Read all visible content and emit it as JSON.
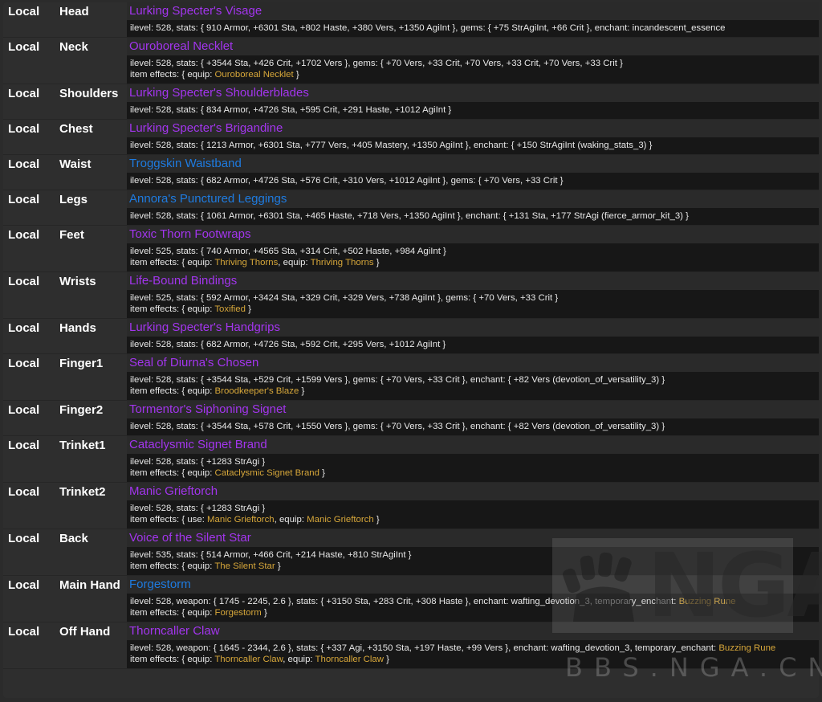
{
  "colors": {
    "epic": "#a335ee",
    "rare": "#1e7be0",
    "effect": "#d7a73a"
  },
  "items": [
    {
      "source": "Local",
      "slot": "Head",
      "name": "Lurking Specter's Visage",
      "quality": "epic",
      "stats": "ilevel: 528, stats: { 910 Armor, +6301 Sta, +802 Haste, +380 Vers, +1350 AgiInt }, gems: { +75 StrAgiInt, +66 Crit }, enchant: incandescent_essence",
      "effects": []
    },
    {
      "source": "Local",
      "slot": "Neck",
      "name": "Ouroboreal Necklet",
      "quality": "epic",
      "stats": "ilevel: 528, stats: { +3544 Sta, +426 Crit, +1702 Vers }, gems: { +70 Vers, +33 Crit, +70 Vers, +33 Crit, +70 Vers, +33 Crit }",
      "effects": [
        {
          "type": "equip",
          "name": "Ouroboreal Necklet"
        }
      ]
    },
    {
      "source": "Local",
      "slot": "Shoulders",
      "name": "Lurking Specter's Shoulderblades",
      "quality": "epic",
      "stats": "ilevel: 528, stats: { 834 Armor, +4726 Sta, +595 Crit, +291 Haste, +1012 AgiInt }",
      "effects": []
    },
    {
      "source": "Local",
      "slot": "Chest",
      "name": "Lurking Specter's Brigandine",
      "quality": "epic",
      "stats": "ilevel: 528, stats: { 1213 Armor, +6301 Sta, +777 Vers, +405 Mastery, +1350 AgiInt }, enchant: { +150 StrAgiInt (waking_stats_3) }",
      "effects": []
    },
    {
      "source": "Local",
      "slot": "Waist",
      "name": "Troggskin Waistband",
      "quality": "rare",
      "stats": "ilevel: 528, stats: { 682 Armor, +4726 Sta, +576 Crit, +310 Vers, +1012 AgiInt }, gems: { +70 Vers, +33 Crit }",
      "effects": []
    },
    {
      "source": "Local",
      "slot": "Legs",
      "name": "Annora's Punctured Leggings",
      "quality": "rare",
      "stats": "ilevel: 528, stats: { 1061 Armor, +6301 Sta, +465 Haste, +718 Vers, +1350 AgiInt }, enchant: { +131 Sta, +177 StrAgi (fierce_armor_kit_3) }",
      "effects": []
    },
    {
      "source": "Local",
      "slot": "Feet",
      "name": "Toxic Thorn Footwraps",
      "quality": "epic",
      "stats": "ilevel: 525, stats: { 740 Armor, +4565 Sta, +314 Crit, +502 Haste, +984 AgiInt }",
      "effects": [
        {
          "type": "equip",
          "name": "Thriving Thorns"
        },
        {
          "type": "equip",
          "name": "Thriving Thorns"
        }
      ]
    },
    {
      "source": "Local",
      "slot": "Wrists",
      "name": "Life-Bound Bindings",
      "quality": "epic",
      "stats": "ilevel: 525, stats: { 592 Armor, +3424 Sta, +329 Crit, +329 Vers, +738 AgiInt }, gems: { +70 Vers, +33 Crit }",
      "effects": [
        {
          "type": "equip",
          "name": "Toxified"
        }
      ]
    },
    {
      "source": "Local",
      "slot": "Hands",
      "name": "Lurking Specter's Handgrips",
      "quality": "epic",
      "stats": "ilevel: 528, stats: { 682 Armor, +4726 Sta, +592 Crit, +295 Vers, +1012 AgiInt }",
      "effects": []
    },
    {
      "source": "Local",
      "slot": "Finger1",
      "name": "Seal of Diurna's Chosen",
      "quality": "epic",
      "stats": "ilevel: 528, stats: { +3544 Sta, +529 Crit, +1599 Vers }, gems: { +70 Vers, +33 Crit }, enchant: { +82 Vers (devotion_of_versatility_3) }",
      "effects": [
        {
          "type": "equip",
          "name": "Broodkeeper's Blaze"
        }
      ]
    },
    {
      "source": "Local",
      "slot": "Finger2",
      "name": "Tormentor's Siphoning Signet",
      "quality": "epic",
      "stats": "ilevel: 528, stats: { +3544 Sta, +578 Crit, +1550 Vers }, gems: { +70 Vers, +33 Crit }, enchant: { +82 Vers (devotion_of_versatility_3) }",
      "effects": []
    },
    {
      "source": "Local",
      "slot": "Trinket1",
      "name": "Cataclysmic Signet Brand",
      "quality": "epic",
      "stats": "ilevel: 528, stats: { +1283 StrAgi }",
      "effects": [
        {
          "type": "equip",
          "name": "Cataclysmic Signet Brand"
        }
      ]
    },
    {
      "source": "Local",
      "slot": "Trinket2",
      "name": "Manic Grieftorch",
      "quality": "epic",
      "stats": "ilevel: 528, stats: { +1283 StrAgi }",
      "effects": [
        {
          "type": "use",
          "name": "Manic Grieftorch"
        },
        {
          "type": "equip",
          "name": "Manic Grieftorch"
        }
      ]
    },
    {
      "source": "Local",
      "slot": "Back",
      "name": "Voice of the Silent Star",
      "quality": "epic",
      "stats": "ilevel: 535, stats: { 514 Armor, +466 Crit, +214 Haste, +810 StrAgiInt }",
      "effects": [
        {
          "type": "equip",
          "name": "The Silent Star"
        }
      ]
    },
    {
      "source": "Local",
      "slot": "Main Hand",
      "name": "Forgestorm",
      "quality": "rare",
      "stats": "ilevel: 528, weapon: { 1745 - 2245, 2.6 }, stats: { +3150 Sta, +283 Crit, +308 Haste }, enchant: wafting_devotion_3, temporary_enchant: ",
      "temp_enchant": "Buzzing Rune",
      "effects": [
        {
          "type": "equip",
          "name": "Forgestorm"
        }
      ]
    },
    {
      "source": "Local",
      "slot": "Off Hand",
      "name": "Thorncaller Claw",
      "quality": "epic",
      "stats": "ilevel: 528, weapon: { 1645 - 2344, 2.6 }, stats: { +337 Agi, +3150 Sta, +197 Haste, +99 Vers }, enchant: wafting_devotion_3, temporary_enchant: ",
      "temp_enchant": "Buzzing Rune",
      "effects": [
        {
          "type": "equip",
          "name": "Thorncaller Claw"
        },
        {
          "type": "equip",
          "name": "Thorncaller Claw"
        }
      ]
    }
  ],
  "labels": {
    "effects_prefix": "item effects: { ",
    "effects_suffix": " }"
  },
  "watermark": {
    "logo": "NGA",
    "sub": "BBS.NGA.CN"
  }
}
